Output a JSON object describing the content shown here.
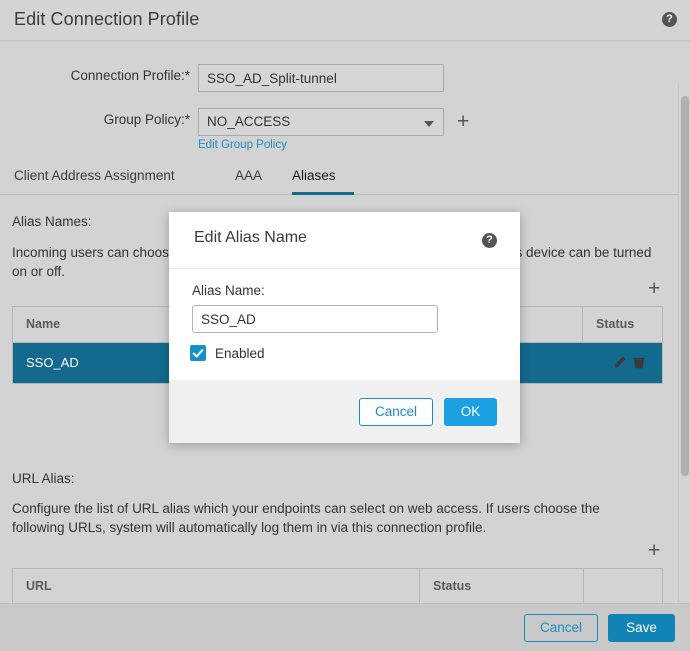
{
  "window": {
    "title": "Edit Connection Profile",
    "help_icon": "help-icon",
    "help_glyph": "?"
  },
  "form": {
    "connection_profile": {
      "label": "Connection Profile:*",
      "value": "SSO_AD_Split-tunnel"
    },
    "group_policy": {
      "label": "Group Policy:*",
      "value": "NO_ACCESS",
      "add_label": "+",
      "edit_link": "Edit Group Policy"
    }
  },
  "tabs": [
    {
      "label": "Client Address Assignment",
      "active": false
    },
    {
      "label": "AAA",
      "active": false
    },
    {
      "label": "Aliases",
      "active": true
    }
  ],
  "alias_section": {
    "heading": "Alias Names:",
    "description": "Incoming users can choose an alias name upon which connections configured on this device can be turned on or off.",
    "add_label": "+",
    "columns": [
      "Name",
      "Status",
      ""
    ],
    "rows": [
      {
        "name": "SSO_AD",
        "status": "",
        "edit_icon": "pencil-icon",
        "delete_icon": "trash-icon"
      }
    ]
  },
  "url_section": {
    "heading": "URL Alias:",
    "description": "Configure the list of URL alias which your endpoints can select on web access. If users choose the following URLs, system will automatically log them in via this connection profile.",
    "add_label": "+",
    "columns": [
      "URL",
      "Status",
      ""
    ],
    "rows": []
  },
  "footer": {
    "cancel_label": "Cancel",
    "save_label": "Save"
  },
  "modal": {
    "title": "Edit Alias Name",
    "help_glyph": "?",
    "alias_name_label": "Alias Name:",
    "alias_name_value": "SSO_AD",
    "enabled_label": "Enabled",
    "enabled_checked": true,
    "cancel_label": "Cancel",
    "ok_label": "OK"
  },
  "colors": {
    "accent_blue": "#1a8cc8",
    "primary_button": "#1ba0e1",
    "save_button": "#1283b5",
    "tab_underline": "#10698f",
    "selected_row": "#136a8e",
    "checkbox": "#1790c8",
    "page_bg": "#d3d3d3",
    "titlebar_bg": "#d4d4d4",
    "footer_bg": "#c9c9c9"
  }
}
